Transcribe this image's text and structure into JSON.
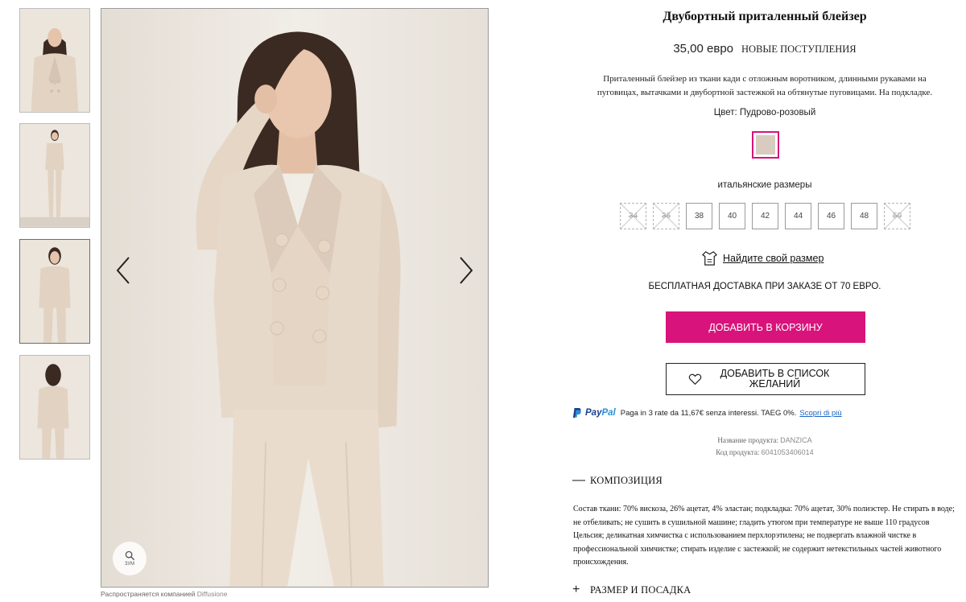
{
  "gallery": {
    "thumbnails": [
      {
        "alt": "front-closeup"
      },
      {
        "alt": "full-front"
      },
      {
        "alt": "three-quarter"
      },
      {
        "alt": "back"
      }
    ],
    "zoom_label": "ЗУМ",
    "distributor_prefix": "Распространяется компанией",
    "distributor_name": "Diffusione"
  },
  "product": {
    "title": "Двубортный приталенный блейзер",
    "price": "35,00 евро",
    "badge": "НОВЫЕ ПОСТУПЛЕНИЯ",
    "description": "Приталенный блейзер из ткани кади с отложным воротником, длинными рукавами на пуговицах, вытачками и двубортной застежкой на обтянутые пуговицами. На подкладке.",
    "color_label": "Цвет: Пудрово-розовый",
    "color_hex": "#d8cbc0",
    "accent_color": "#d8137b",
    "sizes_label": "итальянские размеры",
    "sizes": [
      {
        "label": "34",
        "available": false
      },
      {
        "label": "36",
        "available": false
      },
      {
        "label": "38",
        "available": true
      },
      {
        "label": "40",
        "available": true
      },
      {
        "label": "42",
        "available": true
      },
      {
        "label": "44",
        "available": true
      },
      {
        "label": "46",
        "available": true
      },
      {
        "label": "48",
        "available": true
      },
      {
        "label": "50",
        "available": false
      }
    ],
    "find_size": "Найдите свой размер",
    "shipping": "БЕСПЛАТНАЯ ДОСТАВКА ПРИ ЗАКАЗЕ ОТ 70 ЕВРО.",
    "add_to_cart": "ДОБАВИТЬ В КОРЗИНУ",
    "add_to_wishlist": "ДОБАВИТЬ В СПИСОК ЖЕЛАНИЙ"
  },
  "paypal": {
    "brand": "PayPal",
    "text": "Paga in 3 rate da 11,67€ senza interessi. TAEG 0%.",
    "link": "Scopri di più"
  },
  "meta": {
    "name_label": "Название продукта:",
    "name_value": "DANZICA",
    "code_label": "Код продукта:",
    "code_value": "6041053406014"
  },
  "accordion": {
    "composition": {
      "sign": "—",
      "label": "КОМПОЗИЦИЯ",
      "text": "Состав ткани: 70% вискоза, 26% ацетат, 4% эластан; подкладка: 70% ацетат, 30% полиэстер. Не стирать в воде; не отбеливать; не сушить в сушильной машине; гладить утюгом при температуре не выше 110 градусов Цельсия; деликатная химчистка с использованием перхлорэтилена; не подвергать влажной чистке в профессиональной химчистке; стирать изделие с застежкой; не содержит нетекстильных частей животного происхождения."
    },
    "size_fit": {
      "sign": "+",
      "label": "РАЗМЕР И ПОСАДКА"
    }
  }
}
